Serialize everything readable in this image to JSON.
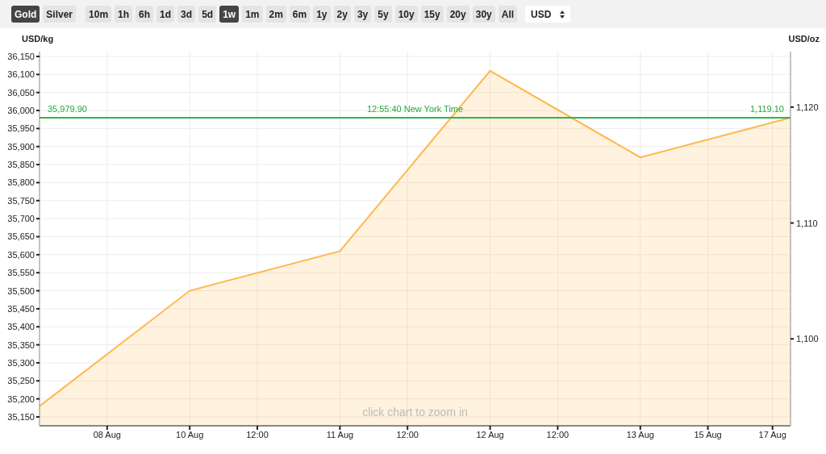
{
  "metal_tabs": [
    {
      "label": "Gold",
      "selected": true
    },
    {
      "label": "Silver",
      "selected": false
    }
  ],
  "range_tabs": [
    {
      "label": "10m",
      "selected": false
    },
    {
      "label": "1h",
      "selected": false
    },
    {
      "label": "6h",
      "selected": false
    },
    {
      "label": "1d",
      "selected": false
    },
    {
      "label": "3d",
      "selected": false
    },
    {
      "label": "5d",
      "selected": false
    },
    {
      "label": "1w",
      "selected": true
    },
    {
      "label": "1m",
      "selected": false
    },
    {
      "label": "2m",
      "selected": false
    },
    {
      "label": "6m",
      "selected": false
    },
    {
      "label": "1y",
      "selected": false
    },
    {
      "label": "2y",
      "selected": false
    },
    {
      "label": "3y",
      "selected": false
    },
    {
      "label": "5y",
      "selected": false
    },
    {
      "label": "10y",
      "selected": false
    },
    {
      "label": "15y",
      "selected": false
    },
    {
      "label": "20y",
      "selected": false
    },
    {
      "label": "30y",
      "selected": false
    },
    {
      "label": "All",
      "selected": false
    }
  ],
  "currency_select": {
    "value": "USD"
  },
  "chart": {
    "chart_data": {
      "type": "area",
      "ylabel": "USD/kg",
      "categories": [
        null,
        "10 Aug",
        "11 Aug",
        "12 Aug",
        "13 Aug",
        null
      ],
      "series": [
        {
          "color": "#ffb84d",
          "values": [
            35180,
            35500,
            35610,
            36110,
            35870,
            35980
          ]
        },
        {
          "type": "line",
          "color": "#2db84a",
          "values": [
            35980,
            35980,
            35980,
            35980,
            35980,
            35980
          ]
        }
      ],
      "ylim": [
        35125.4,
        36163.4
      ],
      "yticks": [
        {
          "value": 36150,
          "label": "36,150"
        },
        {
          "value": 36100,
          "label": "36,100"
        },
        {
          "value": 36050,
          "label": "36,050"
        },
        {
          "value": 36000,
          "label": "36,000"
        },
        {
          "value": 35950,
          "label": "35,950"
        },
        {
          "value": 35900,
          "label": "35,900"
        },
        {
          "value": 35850,
          "label": "35,850"
        },
        {
          "value": 35800,
          "label": "35,800"
        },
        {
          "value": 35750,
          "label": "35,750"
        },
        {
          "value": 35700,
          "label": "35,700"
        },
        {
          "value": 35650,
          "label": "35,650"
        },
        {
          "value": 35600,
          "label": "35,600"
        },
        {
          "value": 35550,
          "label": "35,550"
        },
        {
          "value": 35500,
          "label": "35,500"
        },
        {
          "value": 35450,
          "label": "35,450"
        },
        {
          "value": 35400,
          "label": "35,400"
        },
        {
          "value": 35350,
          "label": "35,350"
        },
        {
          "value": 35300,
          "label": "35,300"
        },
        {
          "value": 35250,
          "label": "35,250"
        },
        {
          "value": 35200,
          "label": "35,200"
        },
        {
          "value": 35150,
          "label": "35,150"
        }
      ],
      "y2label": "USD/oz",
      "y2lim": [
        1092.5,
        1124.79
      ],
      "y2ticks": [
        {
          "value": 1120,
          "label": "1,120"
        },
        {
          "value": 1110,
          "label": "1,110"
        },
        {
          "value": 1100,
          "label": "1,100"
        }
      ],
      "grid": true
    },
    "x_labels_between": [
      [
        "08 Aug"
      ],
      [
        "12:00"
      ],
      [
        "12:00"
      ],
      [
        "12:00"
      ],
      [
        "15 Aug",
        "17 Aug"
      ]
    ],
    "current_price": {
      "kg_label": "35,979.90",
      "time_label": "12:55:40 New York Time",
      "oz_label": "1,119.10"
    },
    "hint": "click chart to zoom in"
  }
}
